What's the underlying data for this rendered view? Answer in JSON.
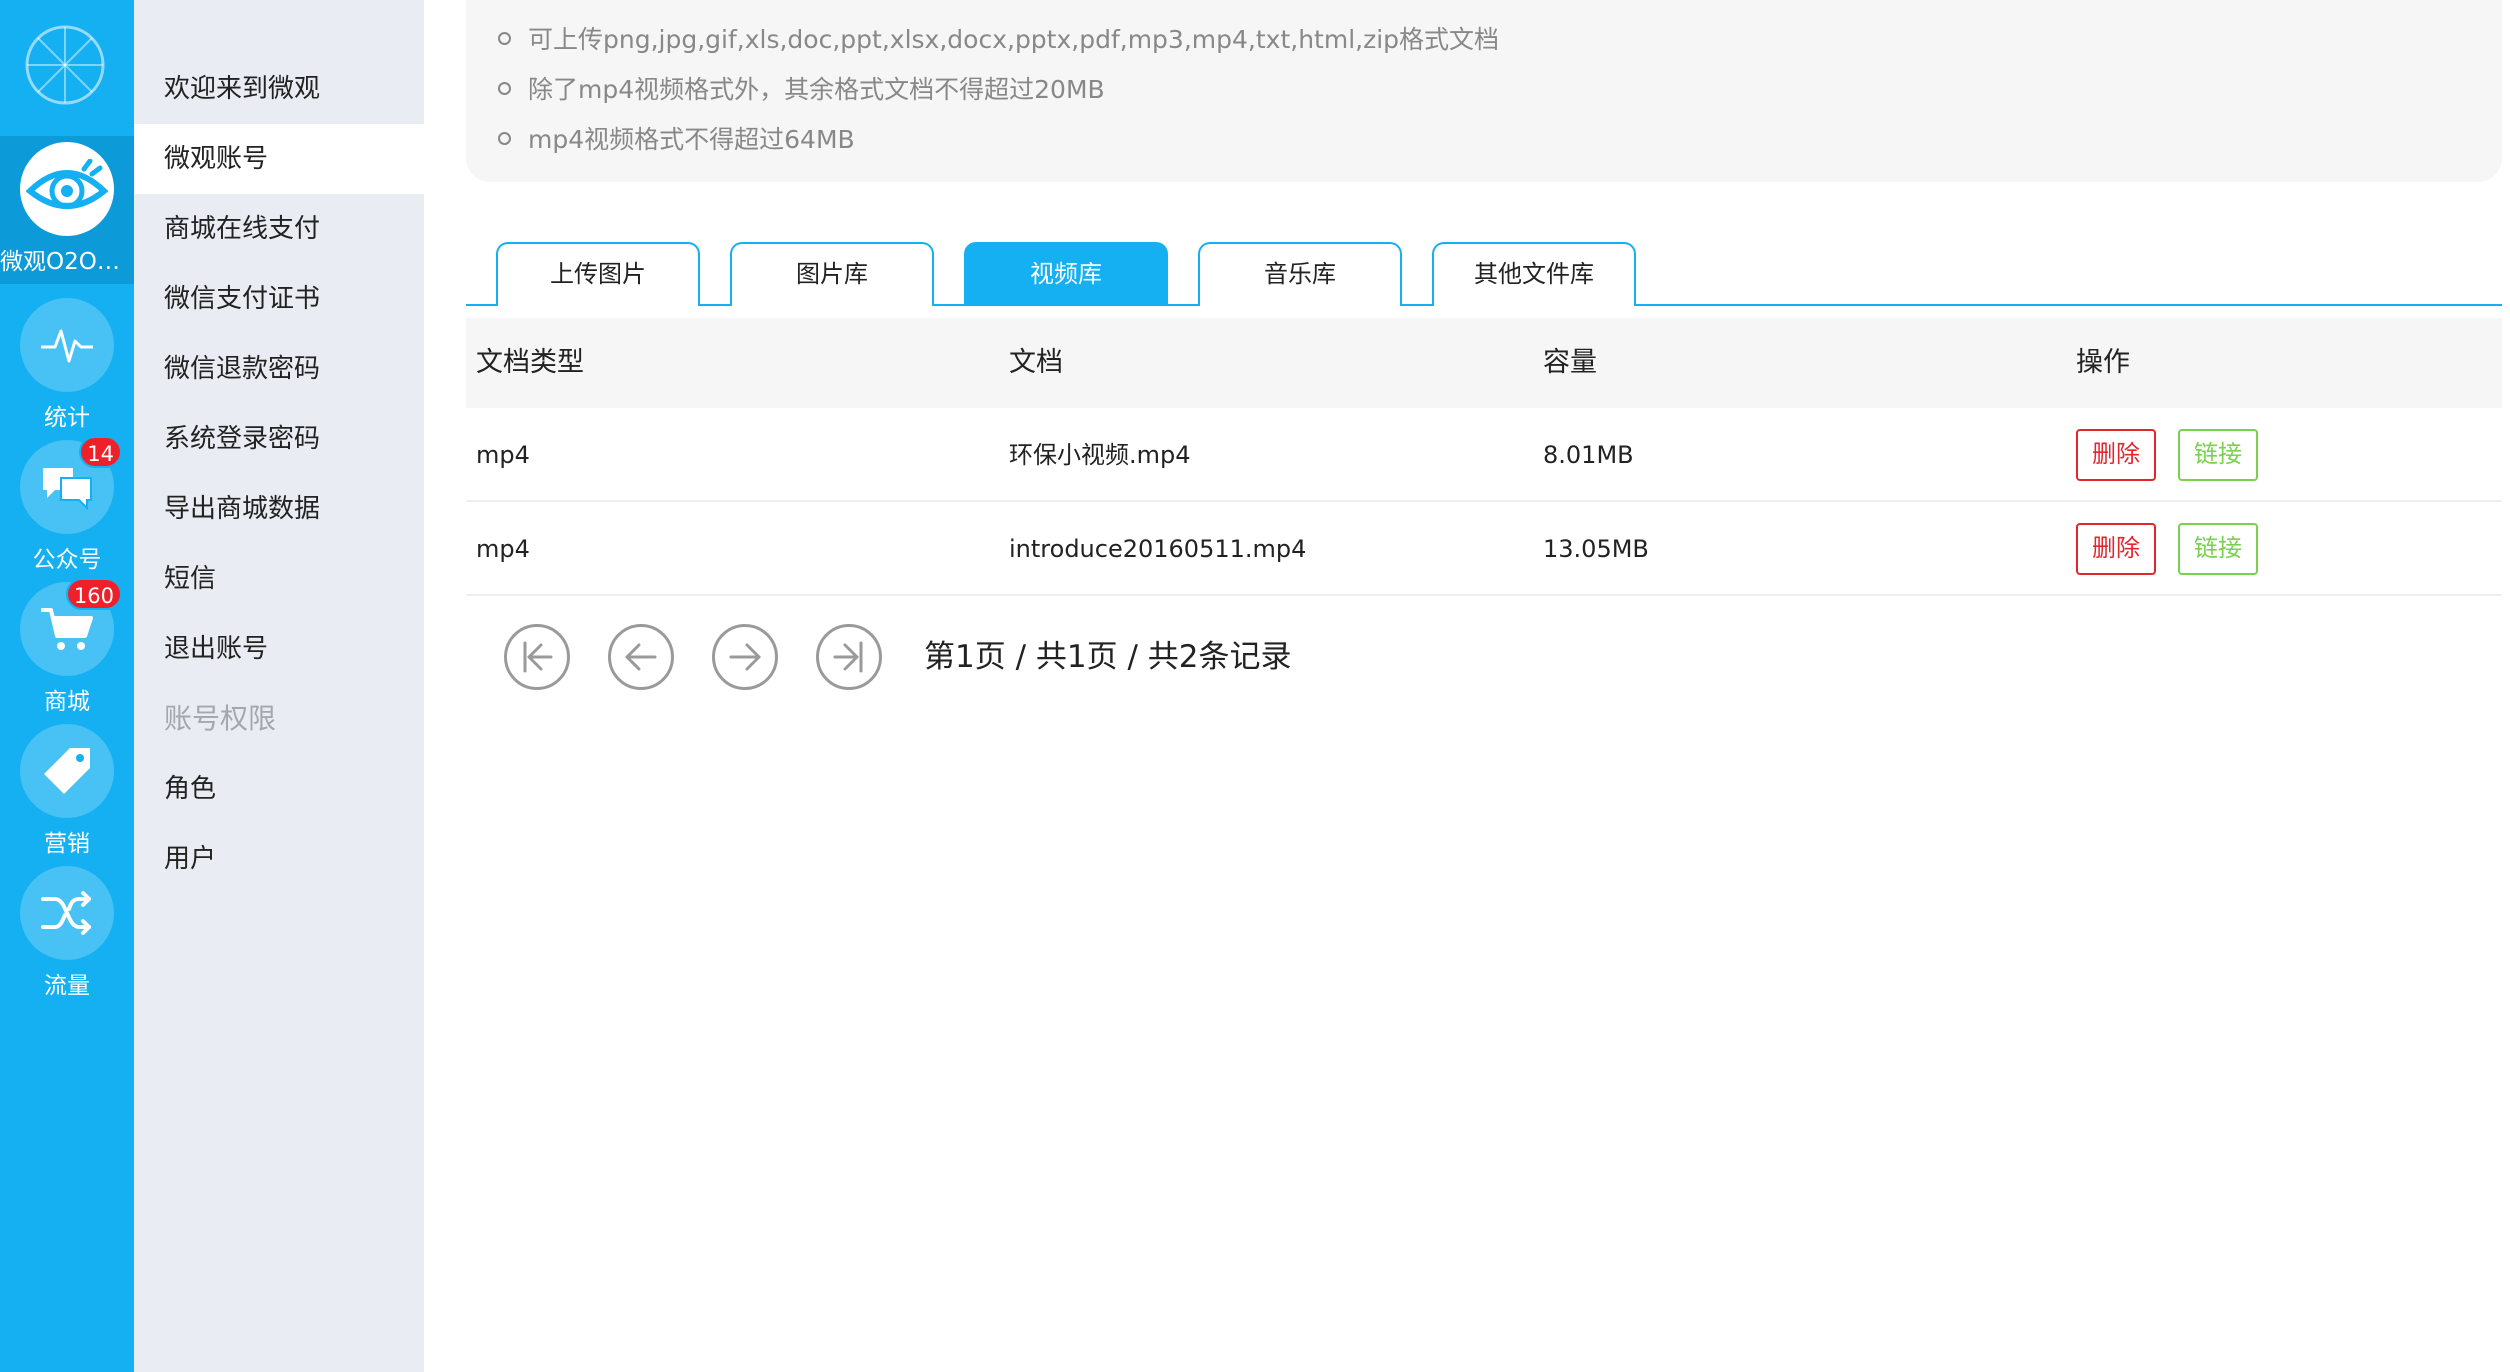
{
  "rail": {
    "items": [
      {
        "label": "微观O2O商..."
      },
      {
        "label": "统计"
      },
      {
        "label": "公众号",
        "badge": "14"
      },
      {
        "label": "商城",
        "badge": "160"
      },
      {
        "label": "营销"
      },
      {
        "label": "流量"
      }
    ]
  },
  "submenu": {
    "items": [
      "欢迎来到微观",
      "微观账号",
      "商城在线支付",
      "微信支付证书",
      "微信退款密码",
      "系统登录密码",
      "导出商城数据",
      "短信",
      "退出账号"
    ],
    "group_title": "账号权限",
    "group_items": [
      "角色",
      "用户"
    ]
  },
  "notes": [
    "可上传png,jpg,gif,xls,doc,ppt,xlsx,docx,pptx,pdf,mp3,mp4,txt,html,zip格式文档",
    "除了mp4视频格式外，其余格式文档不得超过20MB",
    "mp4视频格式不得超过64MB"
  ],
  "tabs": [
    "上传图片",
    "图片库",
    "视频库",
    "音乐库",
    "其他文件库"
  ],
  "table": {
    "headers": [
      "文档类型",
      "文档",
      "容量",
      "操作"
    ],
    "rows": [
      {
        "type": "mp4",
        "name": "环保小视频.mp4",
        "size": "8.01MB"
      },
      {
        "type": "mp4",
        "name": "introduce20160511.mp4",
        "size": "13.05MB"
      }
    ],
    "delete_label": "删除",
    "link_label": "链接"
  },
  "pager": {
    "info": "第1页 / 共1页 / 共2条记录"
  },
  "colors": {
    "accent": "#15b0f2",
    "delete": "#e2262e",
    "link": "#7ad14d",
    "badge": "#f0202a"
  }
}
